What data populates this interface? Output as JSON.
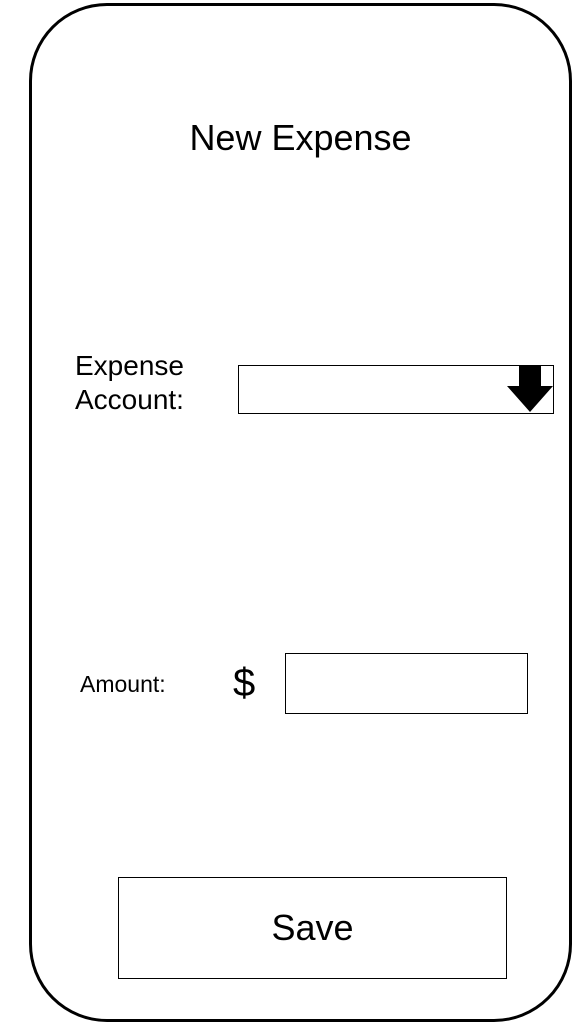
{
  "screen": {
    "title": "New Expense"
  },
  "form": {
    "expense_account": {
      "label_line1": "Expense",
      "label_line2": "Account:",
      "selected_value": "",
      "icon": "down-arrow-icon"
    },
    "amount": {
      "label": "Amount:",
      "currency_symbol": "$",
      "value": "",
      "placeholder": ""
    }
  },
  "actions": {
    "save_label": "Save"
  },
  "colors": {
    "stroke": "#000000",
    "background": "#ffffff"
  }
}
